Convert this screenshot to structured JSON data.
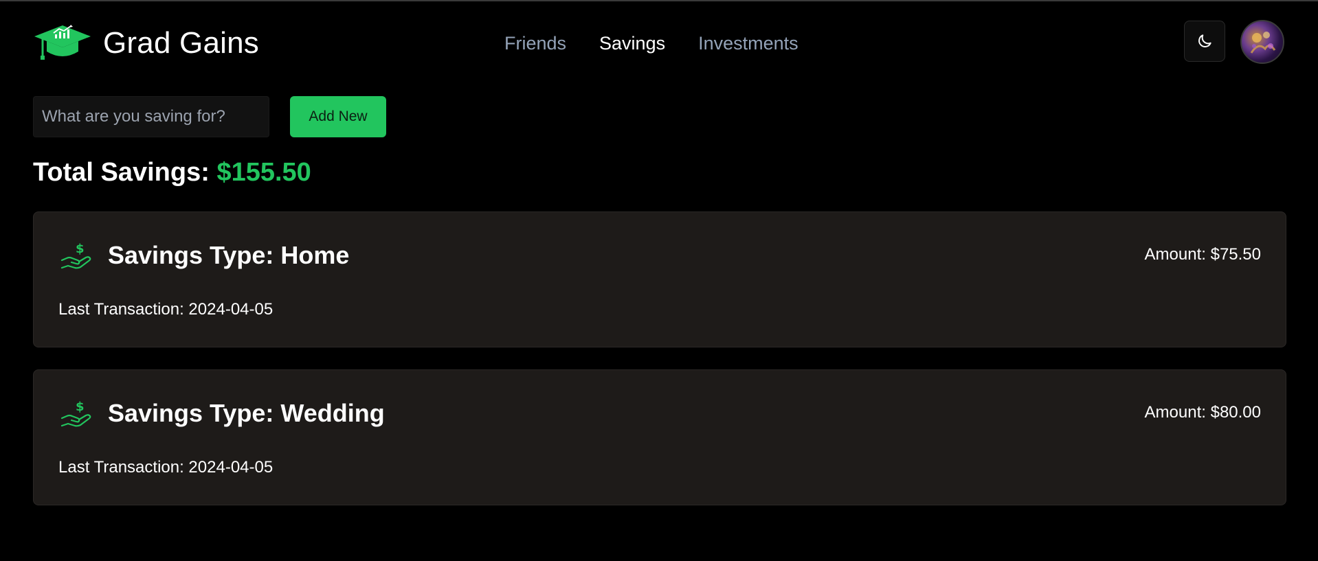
{
  "app": {
    "name": "Grad Gains",
    "logo_icon": "graduation-cap-chart-icon",
    "accent_color": "#22c55e"
  },
  "nav": {
    "items": [
      {
        "label": "Friends",
        "active": false
      },
      {
        "label": "Savings",
        "active": true
      },
      {
        "label": "Investments",
        "active": false
      }
    ]
  },
  "header_actions": {
    "theme_toggle_icon": "moon-icon",
    "avatar_icon": "user-avatar"
  },
  "add_form": {
    "placeholder": "What are you saving for?",
    "value": "",
    "button_label": "Add New"
  },
  "total": {
    "label": "Total Savings:",
    "amount": "$155.50"
  },
  "savings": [
    {
      "icon": "hand-holding-dollar-icon",
      "title": "Savings Type: Home",
      "amount": "Amount: $75.50",
      "last_transaction": "Last Transaction: 2024-04-05"
    },
    {
      "icon": "hand-holding-dollar-icon",
      "title": "Savings Type: Wedding",
      "amount": "Amount: $80.00",
      "last_transaction": "Last Transaction: 2024-04-05"
    }
  ]
}
